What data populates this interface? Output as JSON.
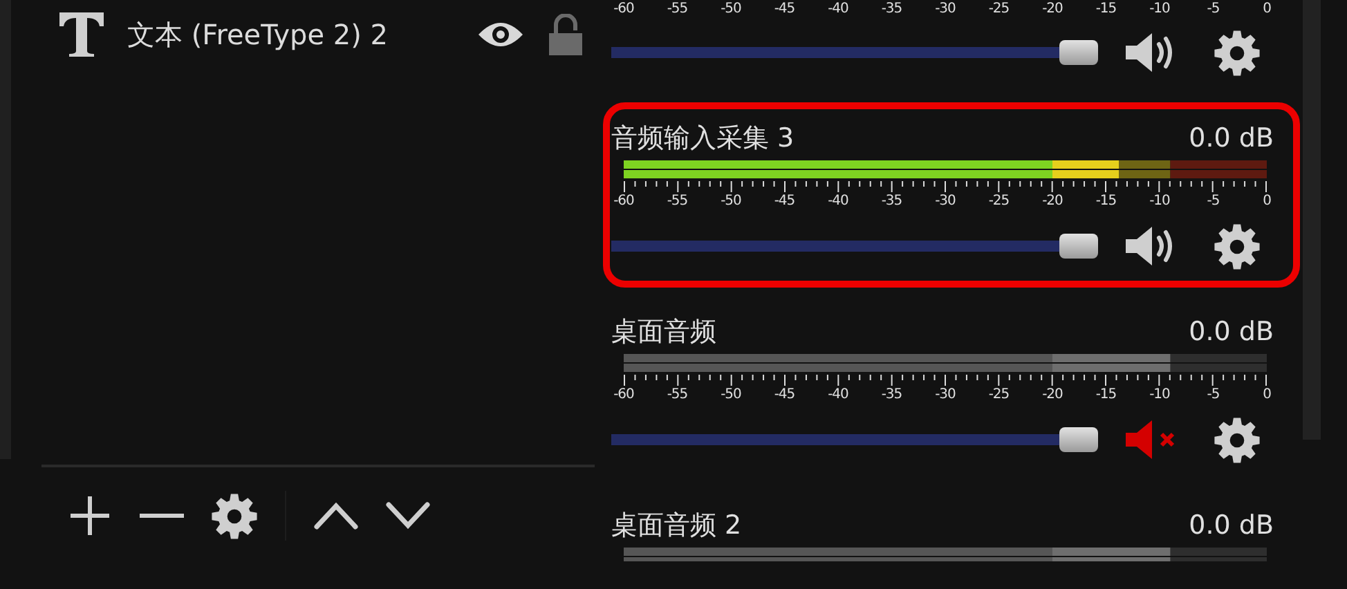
{
  "sources": [
    {
      "kind": "text",
      "name": "文本 (FreeType 2) 2",
      "visible": true,
      "locked": false
    }
  ],
  "mixer": {
    "channels": [
      {
        "scale": [
          "-60",
          "-55",
          "-50",
          "-45",
          "-40",
          "-35",
          "-30",
          "-25",
          "-20",
          "-15",
          "-10",
          "-5",
          "0"
        ],
        "muted": false,
        "volume": {
          "level": 1
        },
        "highlighted": false
      },
      {
        "name": "音频输入采集 3",
        "reading": "0.0 dB",
        "meter": {
          "level": 0.77
        },
        "scale": [
          "-60",
          "-55",
          "-50",
          "-45",
          "-40",
          "-35",
          "-30",
          "-25",
          "-20",
          "-15",
          "-10",
          "-5",
          "0"
        ],
        "muted": false,
        "volume": {
          "level": 1
        },
        "highlighted": true
      },
      {
        "name": "桌面音频",
        "reading": "0.0 dB",
        "meter": {
          "level": 0.85
        },
        "scale": [
          "-60",
          "-55",
          "-50",
          "-45",
          "-40",
          "-35",
          "-30",
          "-25",
          "-20",
          "-15",
          "-10",
          "-5",
          "0"
        ],
        "muted": true,
        "volume": {
          "level": 1
        },
        "highlighted": false
      },
      {
        "name": "桌面音频 2",
        "reading": "0.0 dB",
        "meter": {
          "level": 0.85
        },
        "muted": true,
        "highlighted": false
      }
    ]
  }
}
